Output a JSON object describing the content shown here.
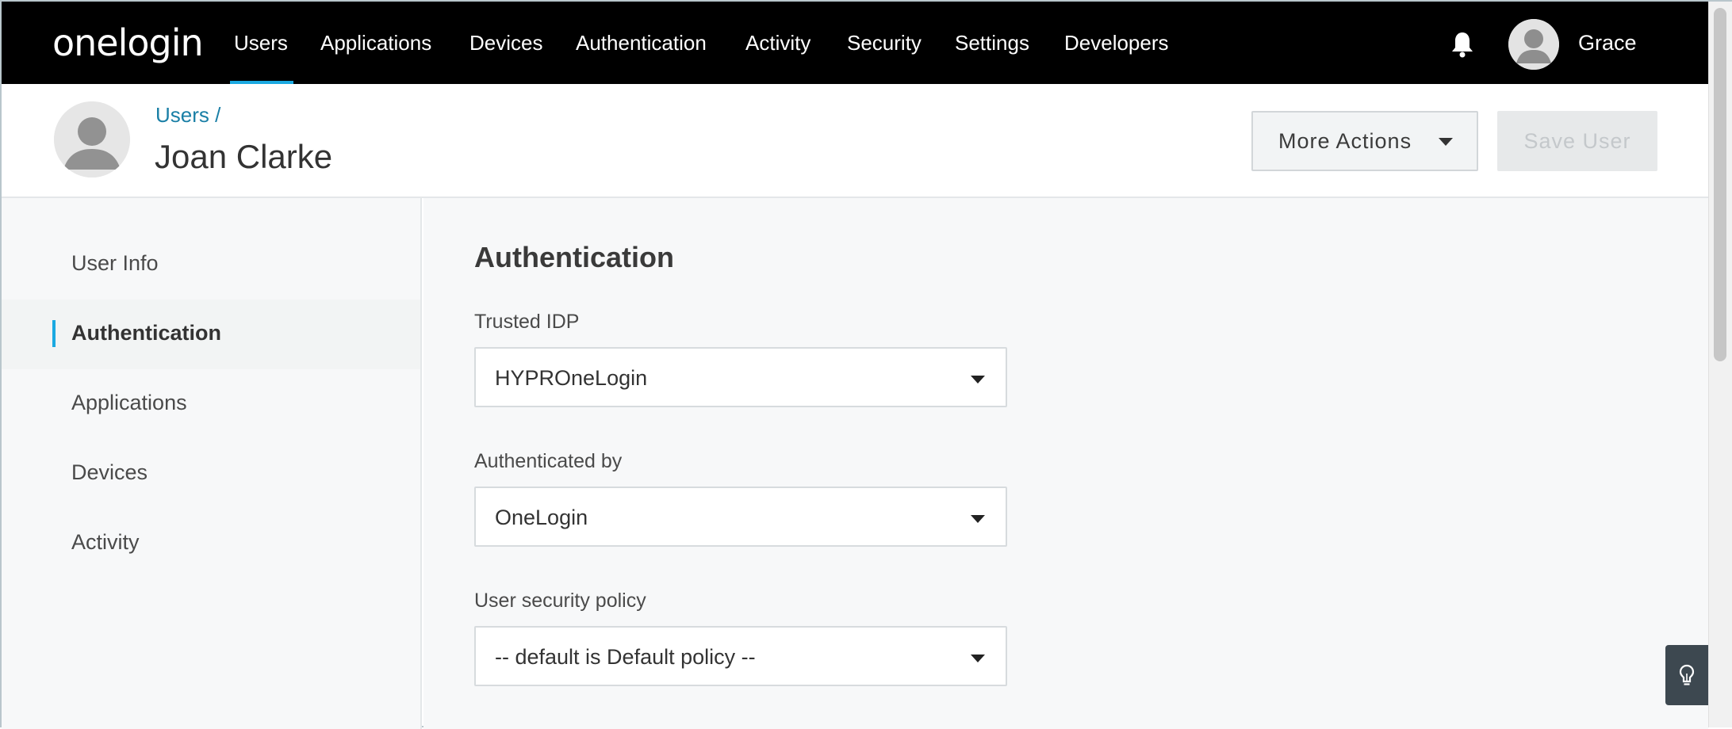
{
  "nav": {
    "logo": "onelogin",
    "items": [
      {
        "label": "Users",
        "active": true
      },
      {
        "label": "Applications"
      },
      {
        "label": "Devices"
      },
      {
        "label": "Authentication"
      },
      {
        "label": "Activity"
      },
      {
        "label": "Security"
      },
      {
        "label": "Settings"
      },
      {
        "label": "Developers"
      }
    ],
    "user_name": "Grace",
    "accent_color": "#1ba9e1"
  },
  "header": {
    "breadcrumb": "Users /",
    "title": "Joan Clarke",
    "more_actions_label": "More Actions",
    "save_label": "Save User"
  },
  "sidebar": {
    "items": [
      {
        "label": "User Info"
      },
      {
        "label": "Authentication",
        "active": true
      },
      {
        "label": "Applications"
      },
      {
        "label": "Devices"
      },
      {
        "label": "Activity"
      }
    ]
  },
  "main": {
    "section_title": "Authentication",
    "fields": [
      {
        "label": "Trusted IDP",
        "value": "HYPROneLogin"
      },
      {
        "label": "Authenticated by",
        "value": "OneLogin"
      },
      {
        "label": "User security policy",
        "value": "-- default is Default policy --"
      }
    ]
  },
  "icons": {
    "bell": "bell-icon",
    "hint": "lightbulb-icon",
    "avatar": "avatar-icon"
  }
}
